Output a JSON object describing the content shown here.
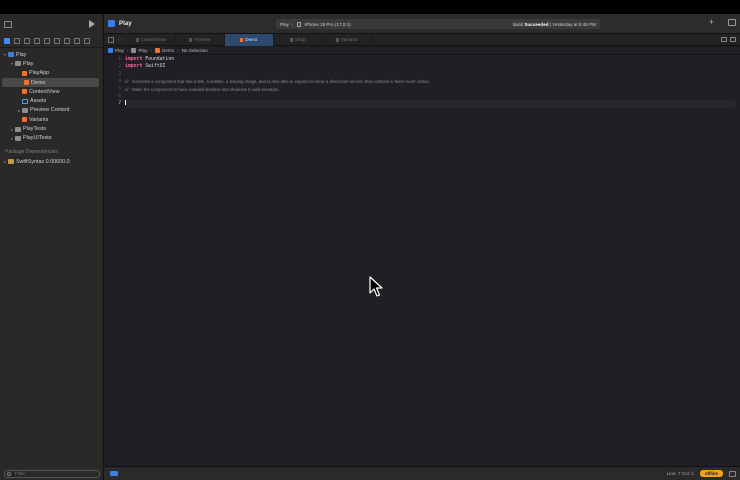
{
  "navigator": {
    "tree": [
      {
        "label": "Play",
        "level": 0,
        "icon": "app-icon",
        "disclosure": "open"
      },
      {
        "label": "Play",
        "level": 1,
        "icon": "folder-icon",
        "disclosure": "open"
      },
      {
        "label": "PlayApp",
        "level": 2,
        "icon": "swift-file-icon",
        "disclosure": ""
      },
      {
        "label": "Demo",
        "level": 2,
        "icon": "swift-file-icon",
        "disclosure": "",
        "selected": true
      },
      {
        "label": "ContentView",
        "level": 2,
        "icon": "swift-file-icon",
        "disclosure": ""
      },
      {
        "label": "Assets",
        "level": 2,
        "icon": "assets-icon",
        "disclosure": ""
      },
      {
        "label": "Preview Content",
        "level": 2,
        "icon": "folder-icon",
        "disclosure": "closed"
      },
      {
        "label": "Variants",
        "level": 2,
        "icon": "swift-file-icon",
        "disclosure": ""
      },
      {
        "label": "PlayTests",
        "level": 1,
        "icon": "folder-icon",
        "disclosure": "closed"
      },
      {
        "label": "PlayUITests",
        "level": 1,
        "icon": "folder-icon",
        "disclosure": "closed"
      }
    ],
    "package_header": "Package Dependencies",
    "packages": [
      {
        "label": "SwiftSyntax 0.00600.0",
        "icon": "package-icon",
        "disclosure": "closed"
      }
    ],
    "filter_placeholder": "Filter"
  },
  "toolbar": {
    "project_title": "Play",
    "scheme": "Play",
    "device": "iPhone 15 Pro (17.0.1)",
    "status_prefix": "Build",
    "status_bold": "Succeeded",
    "status_suffix": "| Yesterday at 9:49 PM"
  },
  "tabs": [
    {
      "label": "ContentView",
      "active": false
    },
    {
      "label": "Preview",
      "active": false
    },
    {
      "label": "Demo",
      "active": true
    },
    {
      "label": "Shop",
      "active": false
    },
    {
      "label": "Variants",
      "active": false
    }
  ],
  "jumpbar": {
    "items": [
      "Play",
      "Play",
      "Demo",
      "No Selection"
    ]
  },
  "editor": {
    "lines": [
      {
        "n": "1",
        "kw": "import",
        "text": " Foundation",
        "comment": ""
      },
      {
        "n": "2",
        "kw": "import",
        "text": " SwiftUI",
        "comment": ""
      },
      {
        "n": "3",
        "kw": "",
        "text": "",
        "comment": ""
      },
      {
        "n": "4",
        "kw": "",
        "text": "",
        "comment": "///   Generate a component that has a title, a subtitle, a leading image, and is also able to expand to show a disclosure section that contains a 'learn more' action."
      },
      {
        "n": "5",
        "kw": "",
        "text": "",
        "comment": "///   Make the component to have rounded borders and shadows to add elevation."
      },
      {
        "n": "6",
        "kw": "",
        "text": "",
        "comment": ""
      },
      {
        "n": "7",
        "kw": "",
        "text": "",
        "comment": "",
        "current": true
      }
    ]
  },
  "statusbar": {
    "position": "Line: 7  Col: 1",
    "badge": "offline"
  },
  "colors": {
    "keyword": "#fc5fa3",
    "accent": "#3a7ee8",
    "badge": "#f2a218"
  }
}
